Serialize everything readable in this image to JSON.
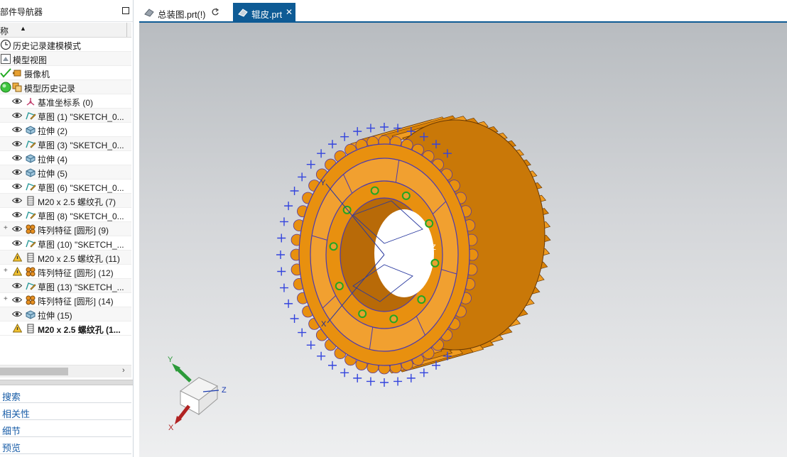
{
  "navigator": {
    "title": "部件导航器",
    "column_name": "称",
    "column_sort": "▲",
    "items": [
      {
        "label": "历史记录建模模式",
        "icon": "clock-icon",
        "name": "tree-item-history-mode"
      },
      {
        "label": "模型视图",
        "icon": "model-view-icon",
        "name": "tree-item-model-views"
      },
      {
        "label": "摄像机",
        "icon": "camera-icon",
        "name": "tree-item-cameras"
      },
      {
        "label": "模型历史记录",
        "icon": "model-history-icon",
        "name": "tree-item-model-history"
      },
      {
        "label": "基准坐标系 (0)",
        "icon": "datum-csys-icon",
        "name": "tree-item-datum-csys"
      },
      {
        "label": "草图 (1) \"SKETCH_0...",
        "icon": "sketch-icon",
        "name": "tree-item-sketch-1"
      },
      {
        "label": "拉伸 (2)",
        "icon": "extrude-icon",
        "name": "tree-item-extrude-2"
      },
      {
        "label": "草图 (3) \"SKETCH_0...",
        "icon": "sketch-icon",
        "name": "tree-item-sketch-3"
      },
      {
        "label": "拉伸 (4)",
        "icon": "extrude-icon",
        "name": "tree-item-extrude-4"
      },
      {
        "label": "拉伸 (5)",
        "icon": "extrude-icon",
        "name": "tree-item-extrude-5"
      },
      {
        "label": "草图 (6) \"SKETCH_0...",
        "icon": "sketch-icon",
        "name": "tree-item-sketch-6"
      },
      {
        "label": "M20 x 2.5 螺纹孔 (7)",
        "icon": "threaded-hole-icon",
        "name": "tree-item-hole-7"
      },
      {
        "label": "草图 (8) \"SKETCH_0...",
        "icon": "sketch-icon",
        "name": "tree-item-sketch-8"
      },
      {
        "label": "阵列特征 [圆形] (9)",
        "icon": "pattern-icon",
        "name": "tree-item-pattern-9"
      },
      {
        "label": "草图 (10) \"SKETCH_...",
        "icon": "sketch-icon",
        "name": "tree-item-sketch-10"
      },
      {
        "label": "M20 x 2.5 螺纹孔 (11)",
        "icon": "threaded-hole-icon",
        "name": "tree-item-hole-11"
      },
      {
        "label": "阵列特征 [圆形] (12)",
        "icon": "pattern-icon",
        "name": "tree-item-pattern-12"
      },
      {
        "label": "草图 (13) \"SKETCH_...",
        "icon": "sketch-icon",
        "name": "tree-item-sketch-13"
      },
      {
        "label": "阵列特征 [圆形] (14)",
        "icon": "pattern-icon",
        "name": "tree-item-pattern-14"
      },
      {
        "label": "拉伸 (15)",
        "icon": "extrude-icon",
        "name": "tree-item-extrude-15"
      },
      {
        "label": "M20 x 2.5 螺纹孔 (1...",
        "icon": "threaded-hole-icon",
        "name": "tree-item-hole-16"
      }
    ],
    "scroll_right": "›"
  },
  "panels": [
    {
      "label": "搜索",
      "name": "panel-search"
    },
    {
      "label": "相关性",
      "name": "panel-dependencies"
    },
    {
      "label": "细节",
      "name": "panel-details"
    },
    {
      "label": "预览",
      "name": "panel-preview"
    }
  ],
  "tabs": [
    {
      "label": "总装图.prt(!)",
      "active": false
    },
    {
      "label": "辊皮.prt",
      "active": true
    }
  ],
  "tab_close": "✕",
  "triad": {
    "y": "Y",
    "z": "Z",
    "x": "X"
  },
  "model_axis": {
    "y": "Y",
    "z": "Z",
    "x": "X"
  },
  "colors": {
    "accent": "#0e5b95",
    "model_orange": "#e8900f",
    "selection_blue": "#3344dd",
    "panel_link": "#1a5ea8"
  }
}
